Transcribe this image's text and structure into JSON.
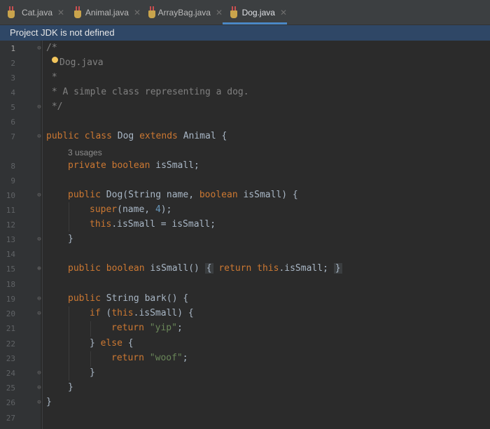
{
  "tabs": [
    {
      "label": "Cat.java",
      "active": false
    },
    {
      "label": "Animal.java",
      "active": false
    },
    {
      "label": "ArrayBag.java",
      "active": false
    },
    {
      "label": "Dog.java",
      "active": true
    }
  ],
  "banner": {
    "text": "Project JDK is not defined"
  },
  "line_numbers": [
    "1",
    "2",
    "3",
    "4",
    "5",
    "6",
    "7",
    "",
    "8",
    "9",
    "10",
    "11",
    "12",
    "13",
    "14",
    "15",
    "18",
    "19",
    "20",
    "21",
    "22",
    "23",
    "24",
    "25",
    "26",
    "27"
  ],
  "code": {
    "l1": "/*",
    "l2": "Dog.java",
    "l3": " *",
    "l4": " * A simple class representing a dog.",
    "l5": " */",
    "l7": [
      "public",
      " ",
      "class",
      " Dog ",
      "extends",
      " Animal {"
    ],
    "usages": "3 usages",
    "l8": [
      "private",
      " ",
      "boolean",
      " isSmall;"
    ],
    "l10": [
      "public",
      " Dog(String name, ",
      "boolean",
      " isSmall) {"
    ],
    "l11": [
      "super",
      "(name, ",
      "4",
      ");"
    ],
    "l12": [
      "this",
      ".isSmall = isSmall;"
    ],
    "l13": "}",
    "l15": [
      "public",
      " ",
      "boolean",
      " isSmall() ",
      "{",
      " ",
      "return",
      " ",
      "this",
      ".isSmall; ",
      "}"
    ],
    "l19": [
      "public",
      " String bark() {"
    ],
    "l20": [
      "if",
      " (",
      "this",
      ".isSmall) {"
    ],
    "l21": [
      "return",
      " ",
      "\"yip\"",
      ";"
    ],
    "l22": [
      "} ",
      "else",
      " {"
    ],
    "l23": [
      "return",
      " ",
      "\"woof\"",
      ";"
    ],
    "l24": "}",
    "l25": "}",
    "l26": "}"
  },
  "colors": {
    "editor_bg": "#2b2b2b",
    "keyword": "#cc7832",
    "string": "#6a8759",
    "number": "#6897bb",
    "comment": "#808080",
    "text": "#a9b7c6",
    "banner_bg": "#2f4766"
  }
}
